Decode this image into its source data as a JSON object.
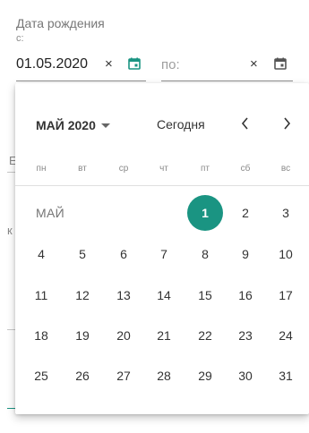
{
  "form": {
    "title": "Дата рождения",
    "from_label": "с:",
    "from_value": "01.05.2020",
    "from_clear": "×",
    "to_placeholder": "по:",
    "to_clear": "×"
  },
  "background": {
    "frag_e": "E",
    "frag_k": "к"
  },
  "datepicker": {
    "month_year": "МАЙ 2020",
    "today": "Сегодня",
    "weekdays": [
      "пн",
      "вт",
      "ср",
      "чт",
      "пт",
      "сб",
      "вс"
    ],
    "month_label": "МАЙ",
    "days": [
      {
        "label": "1",
        "selected": true
      },
      {
        "label": "2"
      },
      {
        "label": "3"
      },
      {
        "label": "4"
      },
      {
        "label": "5"
      },
      {
        "label": "6"
      },
      {
        "label": "7"
      },
      {
        "label": "8"
      },
      {
        "label": "9"
      },
      {
        "label": "10"
      },
      {
        "label": "11"
      },
      {
        "label": "12"
      },
      {
        "label": "13"
      },
      {
        "label": "14"
      },
      {
        "label": "15"
      },
      {
        "label": "16"
      },
      {
        "label": "17"
      },
      {
        "label": "18"
      },
      {
        "label": "19"
      },
      {
        "label": "20"
      },
      {
        "label": "21"
      },
      {
        "label": "22"
      },
      {
        "label": "23"
      },
      {
        "label": "24"
      },
      {
        "label": "25"
      },
      {
        "label": "26"
      },
      {
        "label": "27"
      },
      {
        "label": "28"
      },
      {
        "label": "29"
      },
      {
        "label": "30"
      },
      {
        "label": "31"
      }
    ],
    "first_weekday_index": 4
  },
  "icons": {
    "from_calendar": "calendar-icon",
    "to_calendar": "calendar-icon",
    "prev": "chevron-left-icon",
    "next": "chevron-right-icon",
    "dropdown": "caret-down-icon"
  },
  "colors": {
    "accent": "#1a9482",
    "selected_text": "#ffffff"
  }
}
